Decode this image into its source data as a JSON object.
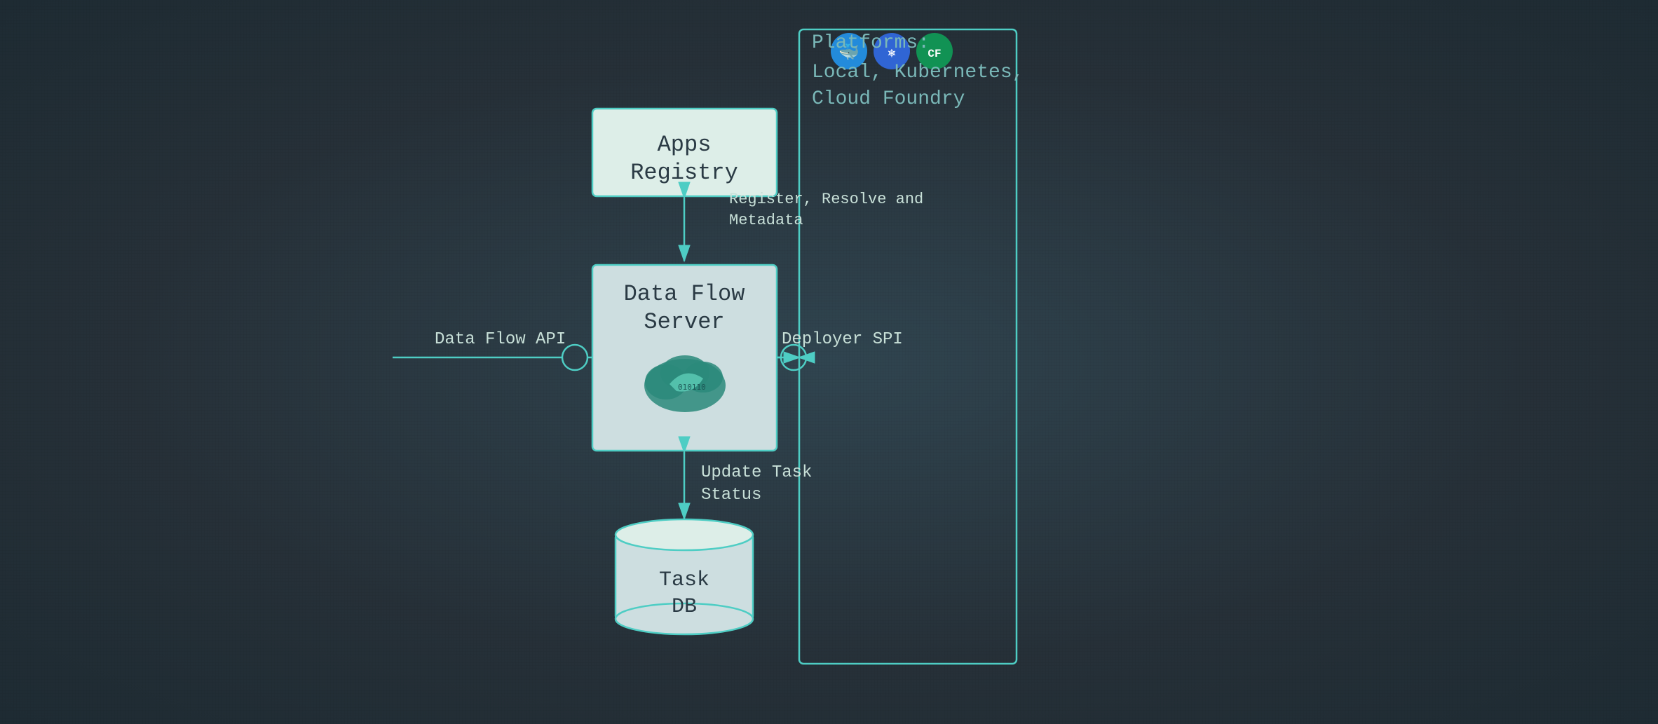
{
  "diagram": {
    "background_color": "#2b3a44",
    "platforms": {
      "title": "Platforms:",
      "subtitle": "Local, Kubernetes,\nCloud Foundry",
      "icons": [
        "docker",
        "kubernetes",
        "cloudfoundry"
      ]
    },
    "apps_registry": {
      "label_line1": "Apps",
      "label_line2": "Registry"
    },
    "data_flow_server": {
      "label_line1": "Data Flow",
      "label_line2": "Server"
    },
    "task_db": {
      "label_line1": "Task",
      "label_line2": "DB"
    },
    "labels": {
      "data_flow_api": "Data Flow API",
      "register_resolve": "Register, Resolve and\nMetadata",
      "deployer_spi": "Deployer SPI",
      "update_task_status": "Update Task\nStatus"
    }
  }
}
